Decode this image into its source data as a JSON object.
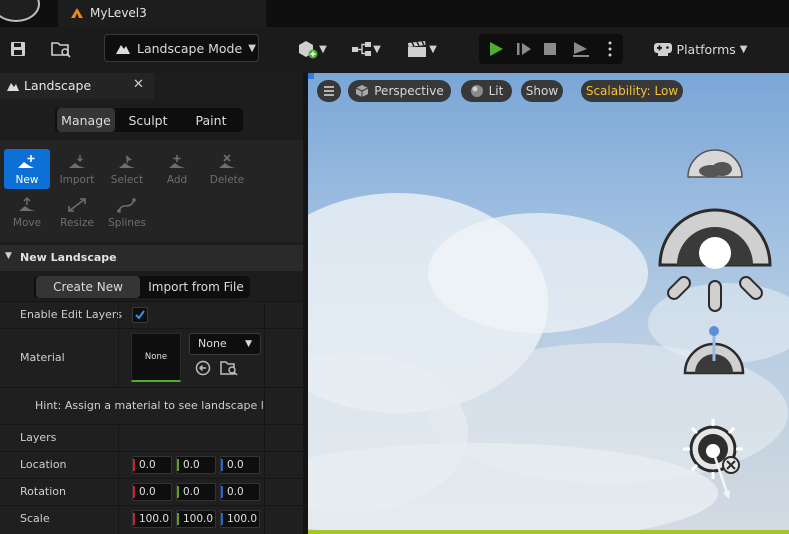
{
  "titlebar": {
    "tab_title": "MyLevel3"
  },
  "toolbar": {
    "mode_label": "Landscape Mode",
    "platforms_label": "Platforms"
  },
  "panel": {
    "title": "Landscape",
    "mode_tabs": [
      "Manage",
      "Sculpt",
      "Paint"
    ],
    "tools_row1": [
      "New",
      "Import",
      "Select",
      "Add",
      "Delete"
    ],
    "tools_row2": [
      "Move",
      "Resize",
      "Splines"
    ],
    "section_title": "New Landscape",
    "create_tabs": [
      "Create New",
      "Import from File"
    ],
    "enable_edit_layers_label": "Enable Edit Layers",
    "enable_edit_layers_checked": true,
    "material_label": "Material",
    "material_thumb_text": "None",
    "material_dropdown": "None",
    "hint": "Hint: Assign a material to see landscape layer",
    "layers_label": "Layers",
    "location_label": "Location",
    "location": [
      "0.0",
      "0.0",
      "0.0"
    ],
    "rotation_label": "Rotation",
    "rotation": [
      "0.0",
      "0.0",
      "0.0"
    ],
    "scale_label": "Scale",
    "scale": [
      "100.0",
      "100.0",
      "100.0"
    ]
  },
  "viewport": {
    "view_label": "Perspective",
    "lit_label": "Lit",
    "show_label": "Show",
    "scalability_label": "Scalability: Low"
  },
  "colors": {
    "accent_blue": "#0d70d6",
    "play_green": "#4caf32",
    "scalability_yellow": "#f3c236"
  }
}
